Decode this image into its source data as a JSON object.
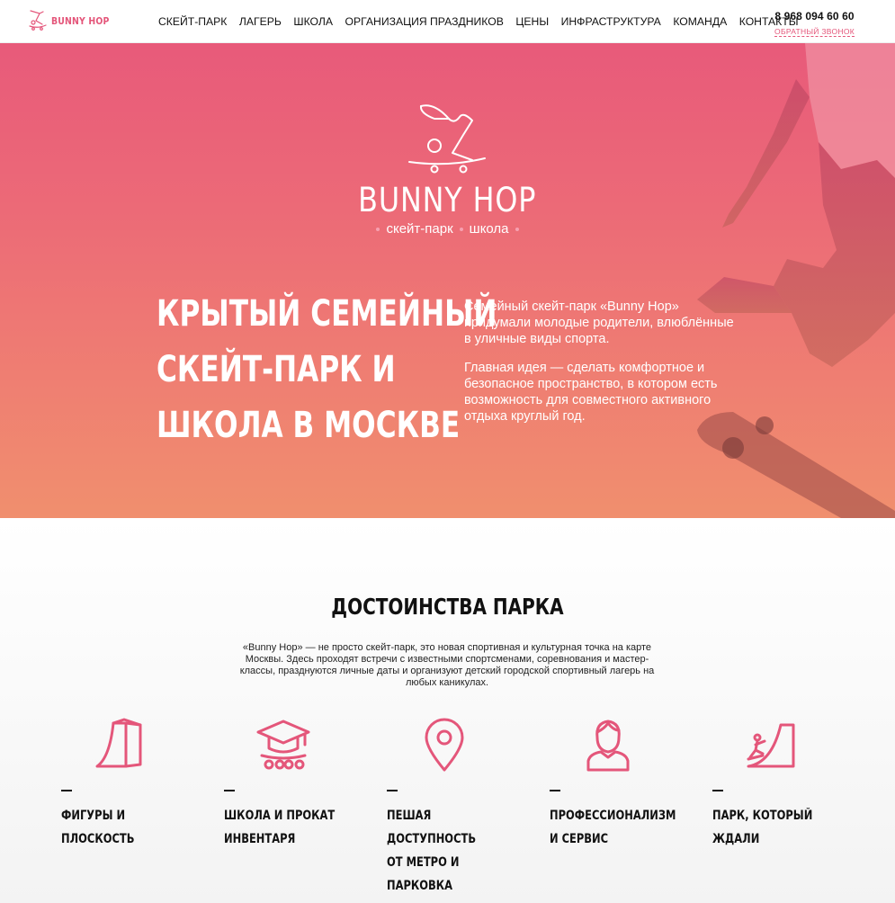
{
  "header": {
    "logo_text": "BUNNY HOP",
    "nav": [
      "СКЕЙТ-ПАРК",
      "ЛАГЕРЬ",
      "ШКОЛА",
      "ОРГАНИЗАЦИЯ ПРАЗДНИКОВ",
      "ЦЕНЫ",
      "ИНФРАСТРУКТУРА",
      "КОМАНДА",
      "КОНТАКТЫ"
    ],
    "phone": "8 968 094 60 60",
    "callback": "ОБРАТНЫЙ ЗВОНОК"
  },
  "hero": {
    "brand": "BUNNY HOP",
    "sub_left": "скейт-парк",
    "sub_right": "школа",
    "title": "КРЫТЫЙ СЕМЕЙНЫЙ\nСКЕЙТ-ПАРК И\nШКОЛА В МОСКВЕ",
    "text1": "Семейный скейт-парк «Bunny Hop» придумали молодые родители, влюблённые в уличные виды спорта.",
    "text2": "Главная идея — сделать комфортное и безопасное пространство, в котором есть возможность для совместного активного отдыха круглый год."
  },
  "advantages": {
    "title": "ДОСТОИНСТВА ПАРКА",
    "description": "«Bunny Hop» — не просто скейт-парк, это новая спортивная и культурная точка на карте Москвы. Здесь проходят встречи с известными спортсменами, соревнования и мастер-классы, празднуются личные даты и организуют детский городской спортивный лагерь на любых каникулах.",
    "items": [
      {
        "icon": "ramp-icon",
        "label": "ФИГУРЫ И\nПЛОСКОСТЬ"
      },
      {
        "icon": "graduation-cap-skateboard-icon",
        "label": "ШКОЛА И ПРОКАТ\nИНВЕНТАРЯ"
      },
      {
        "icon": "location-pin-icon",
        "label": "ПЕШАЯ ДОСТУПНОСТЬ\nОТ МЕТРО И\nПАРКОВКА"
      },
      {
        "icon": "person-icon",
        "label": "ПРОФЕССИОНАЛИЗМ\nИ СЕРВИС"
      },
      {
        "icon": "skater-ramp-icon",
        "label": "ПАРК, КОТОРЫЙ\nЖДАЛИ"
      }
    ]
  },
  "colors": {
    "accent": "#e4567a",
    "hero_top": "#e85a7a",
    "hero_bottom": "#f08f6e"
  }
}
